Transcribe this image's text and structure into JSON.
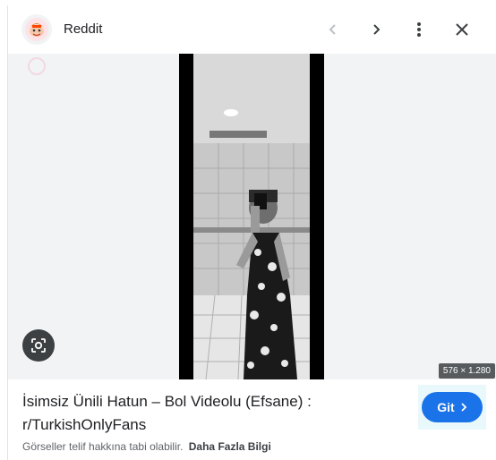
{
  "header": {
    "source_name": "Reddit",
    "prev_label": "‹",
    "next_label": "›",
    "more_label": "⋮",
    "close_label": "✕"
  },
  "image": {
    "dimensions": "576 × 1.280",
    "alt": "Photo"
  },
  "result": {
    "title": "İsimsiz Ünili Hatun – Bol Videolu (Efsane) : r/TurkishOnlyFans",
    "go_label": "Git",
    "copyright_notice": "Görseller telif hakkına tabi olabilir.",
    "more_info": "Daha Fazla Bilgi"
  },
  "colors": {
    "accent": "#1a73e8",
    "image_bg": "#f1f3f4"
  }
}
